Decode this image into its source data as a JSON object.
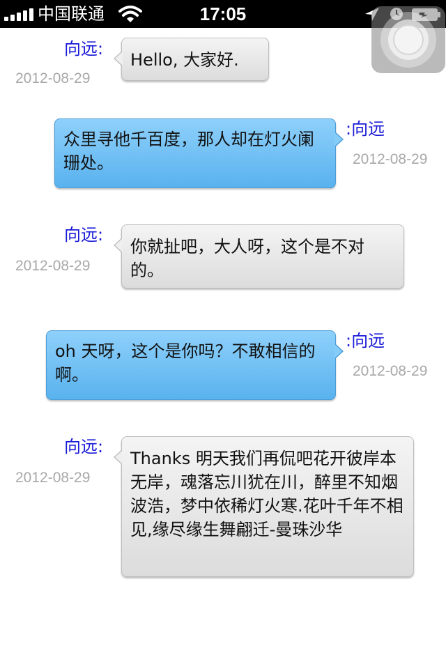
{
  "status_bar": {
    "carrier": "中国联通",
    "time": "17:05",
    "icons": [
      "signal-bars-icon",
      "wifi-icon",
      "location-arrow-icon",
      "alarm-clock-icon",
      "battery-icon"
    ]
  },
  "messages": [
    {
      "side": "incoming",
      "sender": "向远:",
      "date": "2012-08-29",
      "text": "Hello, 大家好."
    },
    {
      "side": "outgoing",
      "sender": ":向远",
      "date": "2012-08-29",
      "text": "众里寻他千百度，那人却在灯火阑珊处。"
    },
    {
      "side": "incoming",
      "sender": "向远:",
      "date": "2012-08-29",
      "text": "你就扯吧，大人呀，这个是不对的。"
    },
    {
      "side": "outgoing",
      "sender": ":向远",
      "date": "2012-08-29",
      "text": "oh 天呀，这个是你吗？不敢相信的啊。"
    },
    {
      "side": "incoming",
      "sender": "向远:",
      "date": "2012-08-29",
      "text": "Thanks 明天我们再侃吧花开彼岸本无岸，魂落忘川犹在川，醉里不知烟波浩，梦中依稀灯火寒.花叶千年不相见,缘尽缘生舞翩迁-曼珠沙华"
    }
  ],
  "colors": {
    "sender_name": "#1a1ad8",
    "date": "#a8a8a8",
    "incoming_bubble": "#e6e6e6",
    "outgoing_bubble": "#6fc0f4"
  }
}
